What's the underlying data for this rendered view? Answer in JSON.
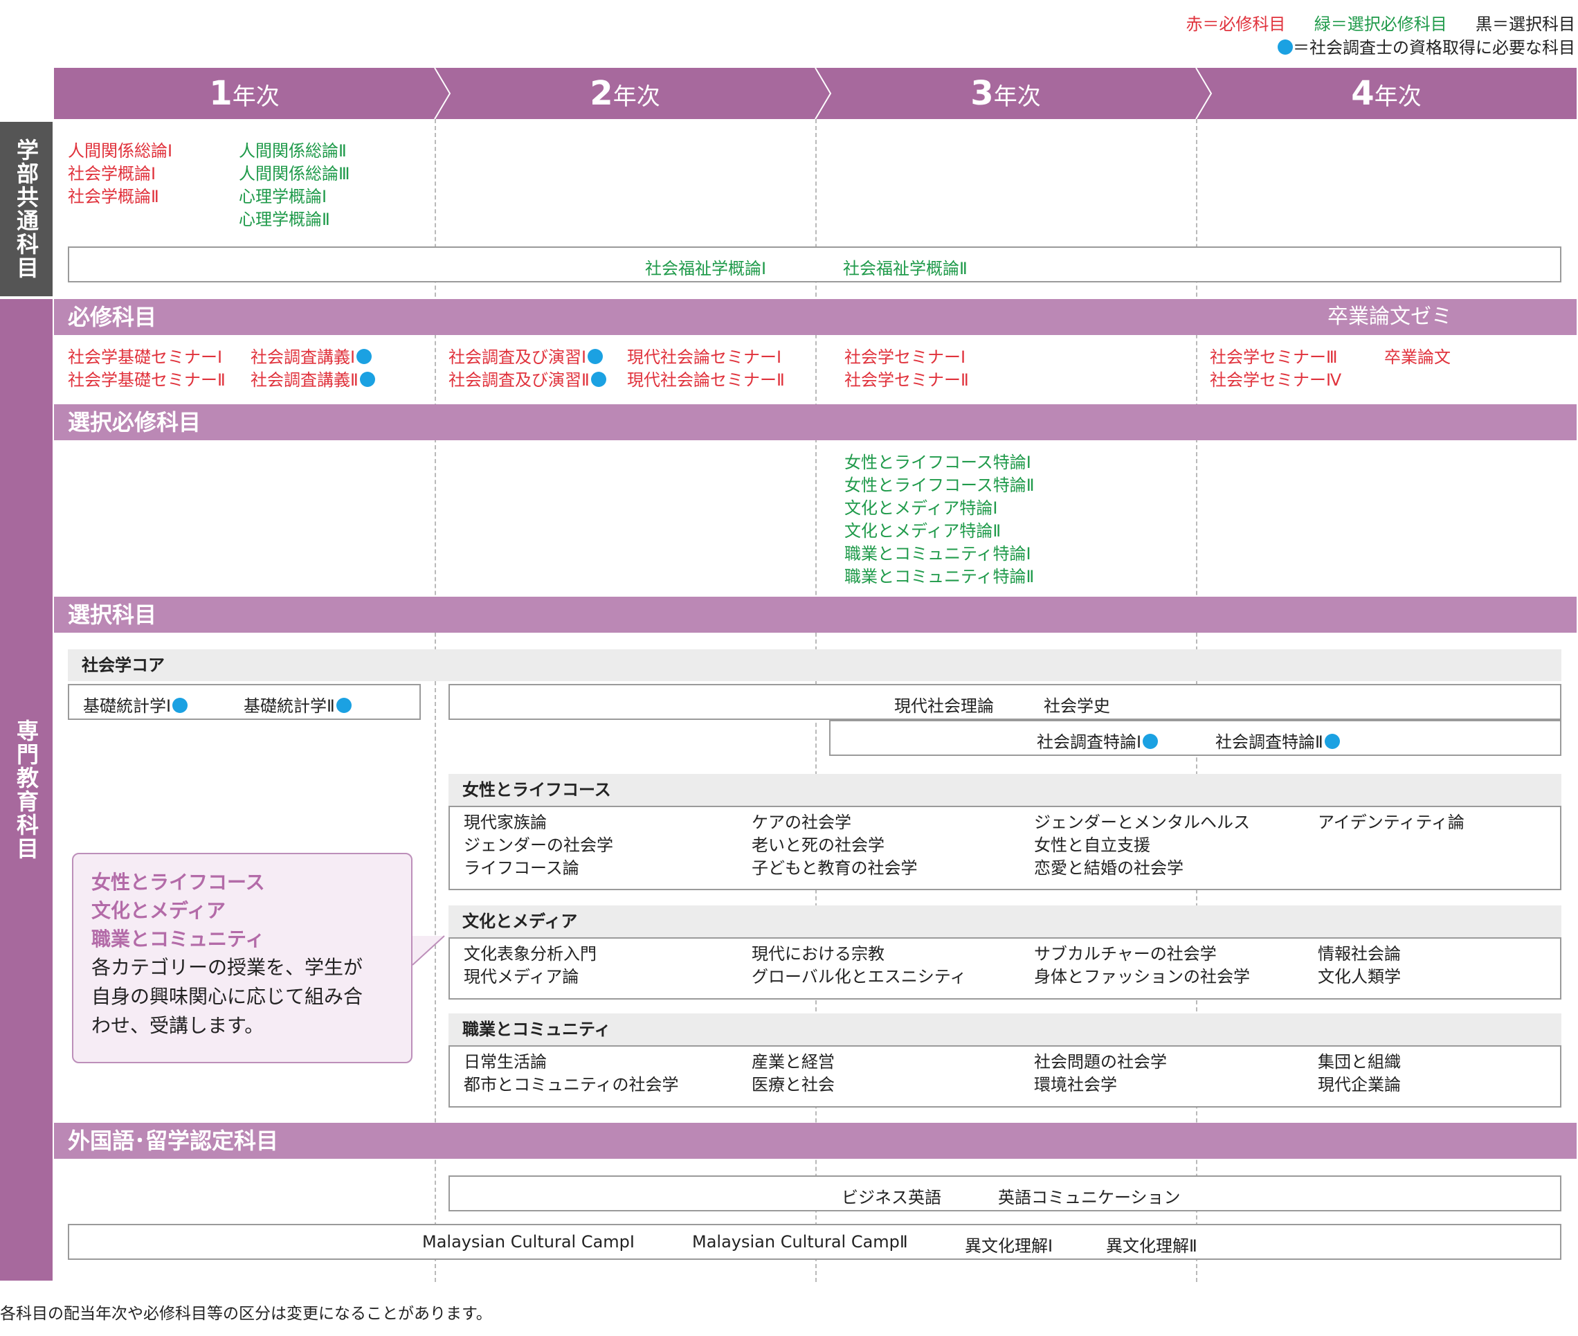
{
  "legend": {
    "red": "赤＝必修科目",
    "green": "緑＝選択必修科目",
    "black": "黒＝選択科目",
    "dot_note": "＝社会調査士の資格取得に必要な科目"
  },
  "years": [
    {
      "num": "1",
      "suffix": "年次"
    },
    {
      "num": "2",
      "suffix": "年次"
    },
    {
      "num": "3",
      "suffix": "年次"
    },
    {
      "num": "4",
      "suffix": "年次"
    }
  ],
  "sidebar": {
    "common": "学部共通科目",
    "specialized": "専門教育科目"
  },
  "common": {
    "y1_required": [
      "人間関係総論Ⅰ",
      "社会学概論Ⅰ",
      "社会学概論Ⅱ"
    ],
    "y1_elective": [
      "人間関係総論Ⅱ",
      "人間関係総論Ⅲ",
      "心理学概論Ⅰ",
      "心理学概論Ⅱ"
    ],
    "welfare": [
      "社会福祉学概論Ⅰ",
      "社会福祉学概論Ⅱ"
    ]
  },
  "required": {
    "title": "必修科目",
    "right_label": "卒業論文ゼミ",
    "y1": [
      {
        "name": "社会学基礎セミナーⅠ",
        "dot": false
      },
      {
        "name": "社会学基礎セミナーⅡ",
        "dot": false
      },
      {
        "name": "社会調査講義Ⅰ",
        "dot": true
      },
      {
        "name": "社会調査講義Ⅱ",
        "dot": true
      }
    ],
    "y2": [
      {
        "name": "社会調査及び演習Ⅰ",
        "dot": true
      },
      {
        "name": "社会調査及び演習Ⅱ",
        "dot": true
      },
      {
        "name": "現代社会論セミナーⅠ",
        "dot": false
      },
      {
        "name": "現代社会論セミナーⅡ",
        "dot": false
      }
    ],
    "y3": [
      "社会学セミナーⅠ",
      "社会学セミナーⅡ"
    ],
    "y4": [
      "社会学セミナーⅢ",
      "社会学セミナーⅣ",
      "卒業論文"
    ]
  },
  "selective_required": {
    "title": "選択必修科目",
    "y3": [
      "女性とライフコース特論Ⅰ",
      "女性とライフコース特論Ⅱ",
      "文化とメディア特論Ⅰ",
      "文化とメディア特論Ⅱ",
      "職業とコミュニティ特論Ⅰ",
      "職業とコミュニティ特論Ⅱ"
    ]
  },
  "elective": {
    "title": "選択科目",
    "core_title": "社会学コア",
    "core_y1": [
      "基礎統計学Ⅰ",
      "基礎統計学Ⅱ"
    ],
    "core_y2": [
      "現代社会理論",
      "社会学史"
    ],
    "core_y3": [
      "社会調査特論Ⅰ",
      "社会調査特論Ⅱ"
    ],
    "women": {
      "title": "女性とライフコース",
      "cols": [
        [
          "現代家族論",
          "ジェンダーの社会学",
          "ライフコース論"
        ],
        [
          "ケアの社会学",
          "老いと死の社会学",
          "子どもと教育の社会学"
        ],
        [
          "ジェンダーとメンタルヘルス",
          "女性と自立支援",
          "恋愛と結婚の社会学"
        ],
        [
          "アイデンティティ論"
        ]
      ]
    },
    "culture": {
      "title": "文化とメディア",
      "cols": [
        [
          "文化表象分析入門",
          "現代メディア論"
        ],
        [
          "現代における宗教",
          "グローバル化とエスニシティ"
        ],
        [
          "サブカルチャーの社会学",
          "身体とファッションの社会学"
        ],
        [
          "情報社会論",
          "文化人類学"
        ]
      ]
    },
    "work": {
      "title": "職業とコミュニティ",
      "cols": [
        [
          "日常生活論",
          "都市とコミュニティの社会学"
        ],
        [
          "産業と経営",
          "医療と社会"
        ],
        [
          "社会問題の社会学",
          "環境社会学"
        ],
        [
          "集団と組織",
          "現代企業論"
        ]
      ]
    }
  },
  "note": {
    "cats": [
      "女性とライフコース",
      "文化とメディア",
      "職業とコミュニティ"
    ],
    "body": [
      "各カテゴリーの授業を、学生が",
      "自身の興味関心に応じて組み合",
      "わせ、受講します。"
    ]
  },
  "foreign": {
    "title": "外国語･留学認定科目",
    "row1": [
      "ビジネス英語",
      "英語コミュニケーション"
    ],
    "row2": [
      "Malaysian Cultural CampⅠ",
      "Malaysian Cultural CampⅡ",
      "異文化理解Ⅰ",
      "異文化理解Ⅱ"
    ]
  },
  "footer": "各科目の配当年次や必修科目等の区分は変更になることがあります。",
  "colors": {
    "header": "#a7699d",
    "category": "#bb88b5",
    "required": "#e0323c",
    "selective_required": "#1f9a4a",
    "dot": "#1ba1e2",
    "common_side": "#555555"
  }
}
